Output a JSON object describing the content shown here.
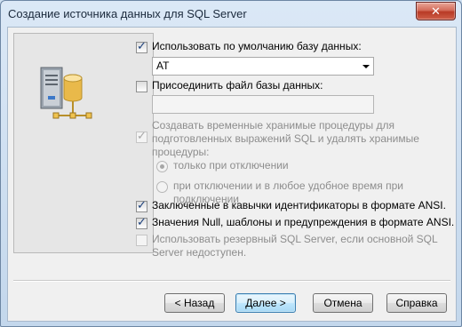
{
  "window": {
    "title": "Создание источника данных для SQL Server",
    "close_glyph": "✕"
  },
  "options": {
    "use_default_db": {
      "label": "Использовать по умолчанию базу данных:",
      "checked": true
    },
    "default_db_value": "AT",
    "attach_file": {
      "label": "Присоединить файл  базы данных:",
      "checked": false
    },
    "attach_file_value": "",
    "temp_procs": {
      "label_lines": [
        "Создавать временные хранимые процедуры для",
        "подготовленных выражений SQL и удалять хранимые",
        "процедуры:"
      ],
      "checked": true,
      "disabled": true
    },
    "radio_on_disconnect": {
      "label": "только при отключении",
      "selected": true
    },
    "radio_on_disconnect_and_anytime": {
      "label": "при отключении и в любое удобное время при подключении",
      "selected": false
    },
    "ansi_quoted": {
      "label": "Заключенные в кавычки идентификаторы в формате ANSI.",
      "checked": true
    },
    "ansi_nulls": {
      "label": "Значения Null, шаблоны и предупреждения в формате ANSI.",
      "checked": true
    },
    "failover": {
      "label_lines": [
        "Использовать резервный SQL Server, если основной SQL",
        "Server недоступен."
      ],
      "checked": false,
      "disabled": true
    }
  },
  "buttons": {
    "back": "< Назад",
    "next": "Далее >",
    "cancel": "Отмена",
    "help": "Справка"
  },
  "icons": {
    "close": "close-icon",
    "server": "server-database-icon",
    "dropdown": "chevron-down-icon"
  }
}
